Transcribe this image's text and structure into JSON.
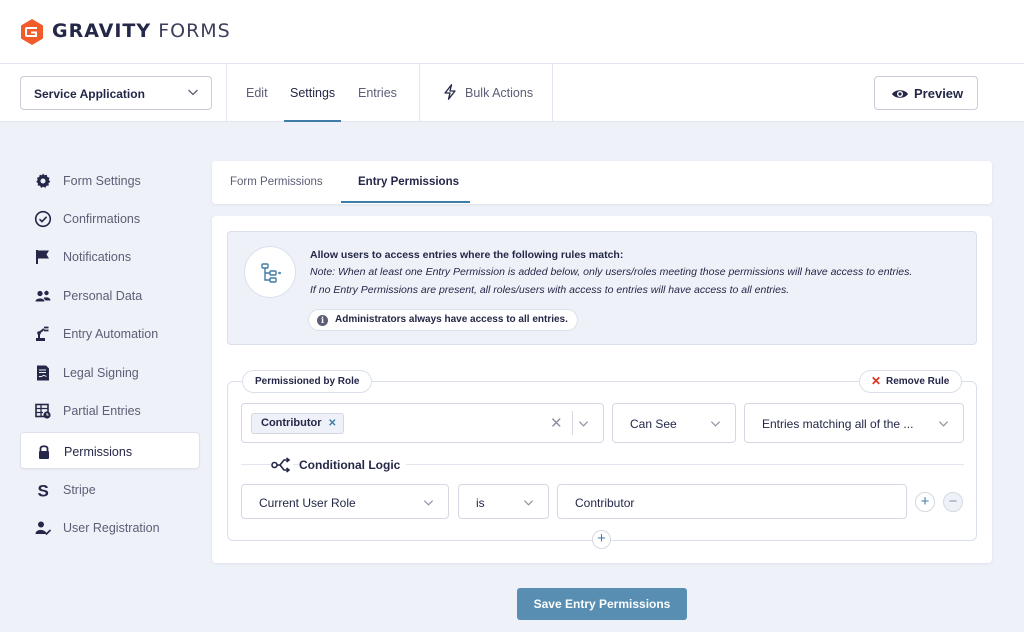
{
  "brand": {
    "name_bold": "GRAVITY",
    "name_light": "FORMS",
    "accent": "#f15a2b"
  },
  "toolbar": {
    "form_name": "Service Application",
    "tabs": [
      {
        "label": "Edit",
        "active": false
      },
      {
        "label": "Settings",
        "active": true
      },
      {
        "label": "Entries",
        "active": false
      }
    ],
    "bulk_actions": "Bulk Actions",
    "preview": "Preview"
  },
  "sidebar": {
    "items": [
      {
        "label": "Form Settings",
        "icon": "gear-icon"
      },
      {
        "label": "Confirmations",
        "icon": "check-circle-icon"
      },
      {
        "label": "Notifications",
        "icon": "flag-icon"
      },
      {
        "label": "Personal Data",
        "icon": "users-icon"
      },
      {
        "label": "Entry Automation",
        "icon": "robot-arm-icon"
      },
      {
        "label": "Legal Signing",
        "icon": "signature-icon"
      },
      {
        "label": "Partial Entries",
        "icon": "partial-table-icon"
      },
      {
        "label": "Permissions",
        "icon": "lock-icon",
        "active": true
      },
      {
        "label": "Stripe",
        "icon": "stripe-icon"
      },
      {
        "label": "User Registration",
        "icon": "user-check-icon"
      }
    ]
  },
  "subtabs": [
    {
      "label": "Form Permissions",
      "active": false
    },
    {
      "label": "Entry Permissions",
      "active": true
    }
  ],
  "notice": {
    "title": "Allow users to access entries where the following rules match:",
    "line1": "Note: When at least one Entry Permission is added below, only users/roles meeting those permissions will have access to entries.",
    "line2": "If no Entry Permissions are present, all roles/users with access to entries will have access to all entries.",
    "admin_note": "Administrators always have access to all entries."
  },
  "rule": {
    "type_label": "Permissioned by Role",
    "remove_label": "Remove Rule",
    "role_tag": "Contributor",
    "access": "Can See",
    "scope": "Entries matching all of the ...",
    "conditional_logic_label": "Conditional Logic",
    "condition": {
      "field": "Current User Role",
      "operator": "is",
      "value": "Contributor"
    }
  },
  "save_button": "Save Entry Permissions",
  "colors": {
    "primary": "#3e7da6",
    "danger": "#dd301d",
    "text": "#242748",
    "muted": "#5b5e76",
    "bg": "#eef2f8"
  }
}
